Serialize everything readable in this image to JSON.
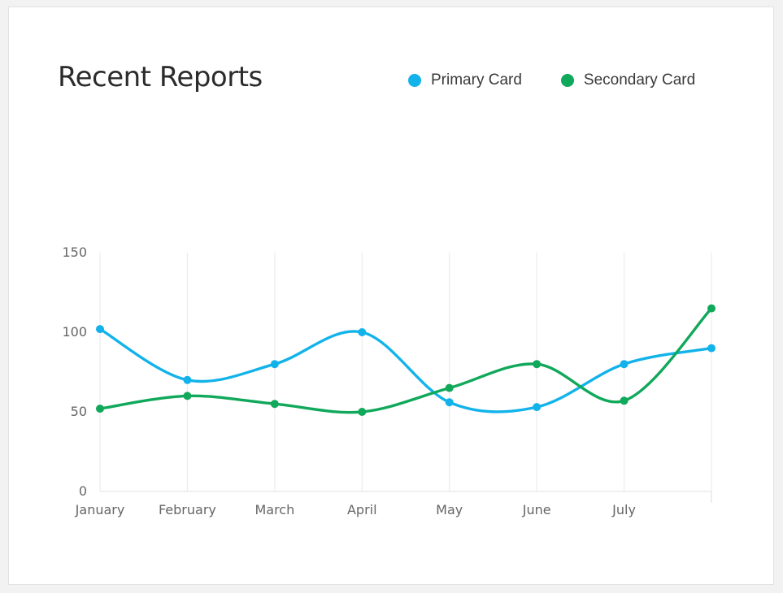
{
  "card": {
    "title": "Recent Reports"
  },
  "chart_data": {
    "type": "line",
    "title": "Recent Reports",
    "categories": [
      "January",
      "February",
      "March",
      "April",
      "May",
      "June",
      "July",
      ""
    ],
    "series": [
      {
        "name": "Primary Card",
        "color": "#12b3ea",
        "values": [
          102,
          70,
          80,
          100,
          56,
          53,
          80,
          90
        ]
      },
      {
        "name": "Secondary Card",
        "color": "#10a85a",
        "values": [
          52,
          60,
          55,
          50,
          65,
          80,
          57,
          115
        ]
      }
    ],
    "yticks": [
      0,
      50,
      100,
      150
    ],
    "ylim": [
      0,
      150
    ],
    "xlabel": "",
    "ylabel": "",
    "grid": "vertical",
    "legend_position": "top-right",
    "smooth": true
  }
}
